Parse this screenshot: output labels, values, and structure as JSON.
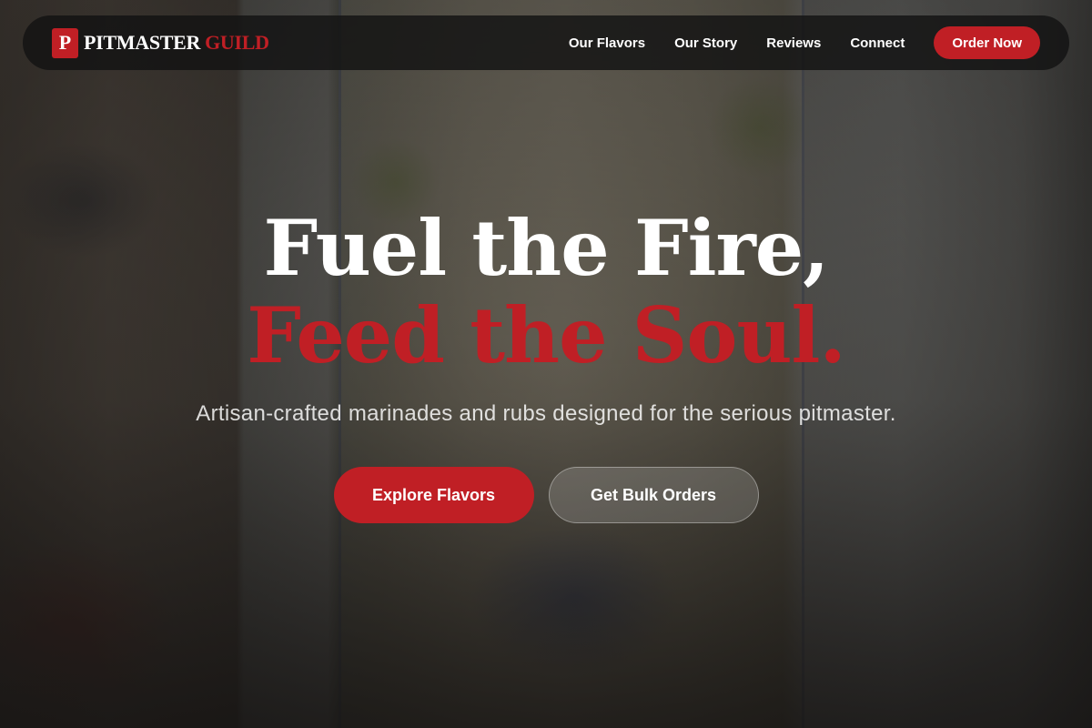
{
  "brand": {
    "mark": "P",
    "name_part1": "PITMASTER",
    "name_part2": "GUILD"
  },
  "nav": {
    "links": [
      "Our Flavors",
      "Our Story",
      "Reviews",
      "Connect"
    ],
    "cta_label": "Order Now"
  },
  "hero": {
    "headline_line1": "Fuel the Fire,",
    "headline_line2": "Feed the Soul.",
    "subtitle": "Artisan-crafted marinades and rubs designed for the serious pitmaster.",
    "primary_button": "Explore Flavors",
    "secondary_button": "Get Bulk Orders"
  },
  "colors": {
    "accent": "#c01f25",
    "nav_background": "#121212"
  }
}
